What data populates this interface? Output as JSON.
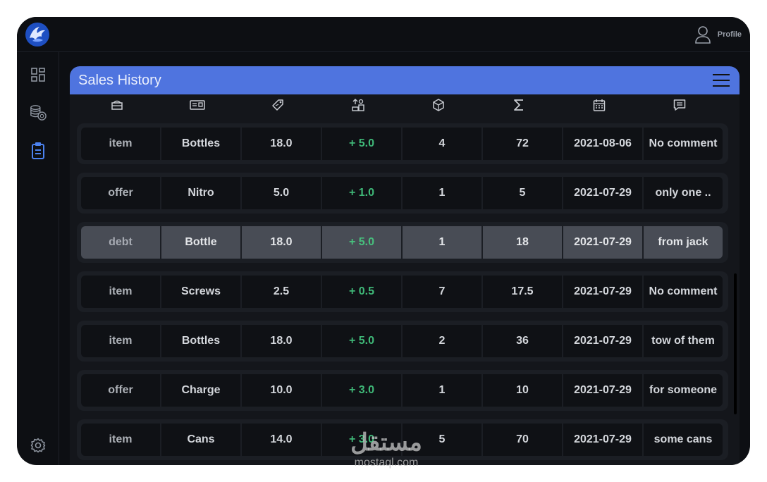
{
  "header": {
    "profile_label": "Profile"
  },
  "sidebar": {
    "items": [
      {
        "icon": "dashboard-icon",
        "active": false
      },
      {
        "icon": "coins-icon",
        "active": false
      },
      {
        "icon": "clipboard-icon",
        "active": true
      }
    ],
    "settings_icon": "gear-icon"
  },
  "panel": {
    "title": "Sales History",
    "columns": [
      "type-icon",
      "receipt-icon",
      "price-tag-icon",
      "profit-icon",
      "box-icon",
      "sigma-icon",
      "calendar-icon",
      "comment-icon"
    ]
  },
  "rows": [
    {
      "type": "item",
      "name": "Bottles",
      "price": "18.0",
      "profit": "+ 5.0",
      "qty": "4",
      "total": "72",
      "date": "2021-08-06",
      "comment": "No comment"
    },
    {
      "type": "offer",
      "name": "Nitro",
      "price": "5.0",
      "profit": "+ 1.0",
      "qty": "1",
      "total": "5",
      "date": "2021-07-29",
      "comment": "only one .."
    },
    {
      "type": "debt",
      "name": "Bottle",
      "price": "18.0",
      "profit": "+ 5.0",
      "qty": "1",
      "total": "18",
      "date": "2021-07-29",
      "comment": "from jack"
    },
    {
      "type": "item",
      "name": "Screws",
      "price": "2.5",
      "profit": "+ 0.5",
      "qty": "7",
      "total": "17.5",
      "date": "2021-07-29",
      "comment": "No comment"
    },
    {
      "type": "item",
      "name": "Bottles",
      "price": "18.0",
      "profit": "+ 5.0",
      "qty": "2",
      "total": "36",
      "date": "2021-07-29",
      "comment": "tow of them"
    },
    {
      "type": "offer",
      "name": "Charge",
      "price": "10.0",
      "profit": "+ 3.0",
      "qty": "1",
      "total": "10",
      "date": "2021-07-29",
      "comment": "for someone"
    },
    {
      "type": "item",
      "name": "Cans",
      "price": "14.0",
      "profit": "+ 3.0",
      "qty": "5",
      "total": "70",
      "date": "2021-07-29",
      "comment": "some cans"
    }
  ],
  "selected_row": 2,
  "colors": {
    "accent": "#4f74df",
    "gain": "#3fb878",
    "active_icon": "#4b82f0"
  },
  "watermark": {
    "script": "مستقل",
    "url": "mostaql.com"
  }
}
